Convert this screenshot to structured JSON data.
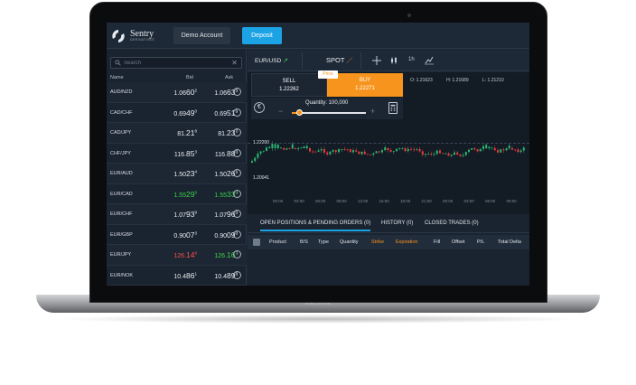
{
  "device": {
    "brand": "MacBook"
  },
  "topbar": {
    "logo_name": "Sentry",
    "logo_sub": "DERIVATIVES",
    "demo_label": "Demo Account",
    "deposit_label": "Deposit"
  },
  "watchlist": {
    "search_placeholder": "Search",
    "clear_glyph": "✕",
    "headers": {
      "name": "Name",
      "bid": "Bid",
      "ask": "Ask"
    },
    "rows": [
      {
        "symbol": "AUD/NZD",
        "bid_pre": "1.06",
        "bid_big": "60",
        "bid_sup": "2",
        "bid_color": "",
        "ask_pre": "1.06",
        "ask_big": "63",
        "ask_sup": "5",
        "ask_color": ""
      },
      {
        "symbol": "CAD/CHF",
        "bid_pre": "0.69",
        "bid_big": "49",
        "bid_sup": "0",
        "bid_color": "",
        "ask_pre": "0.69",
        "ask_big": "51",
        "ask_sup": "9",
        "ask_color": ""
      },
      {
        "symbol": "CAD/JPY",
        "bid_pre": "81.",
        "bid_big": "21",
        "bid_sup": "8",
        "bid_color": "",
        "ask_pre": "81.",
        "ask_big": "23",
        "ask_sup": "7",
        "ask_color": ""
      },
      {
        "symbol": "CHF/JPY",
        "bid_pre": "116.",
        "bid_big": "85",
        "bid_sup": "3",
        "bid_color": "",
        "ask_pre": "116.",
        "ask_big": "88",
        "ask_sup": "0",
        "ask_color": ""
      },
      {
        "symbol": "EUR/AUD",
        "bid_pre": "1.50",
        "bid_big": "23",
        "bid_sup": "4",
        "bid_color": "",
        "ask_pre": "1.50",
        "ask_big": "26",
        "ask_sup": "1",
        "ask_color": ""
      },
      {
        "symbol": "EUR/CAD",
        "bid_pre": "1.55",
        "bid_big": "29",
        "bid_sup": "9",
        "bid_color": "green",
        "ask_pre": "1.55",
        "ask_big": "33",
        "ask_sup": "0",
        "ask_color": "green"
      },
      {
        "symbol": "EUR/CHF",
        "bid_pre": "1.07",
        "bid_big": "93",
        "bid_sup": "9",
        "bid_color": "",
        "ask_pre": "1.07",
        "ask_big": "96",
        "ask_sup": "0",
        "ask_color": ""
      },
      {
        "symbol": "EUR/GBP",
        "bid_pre": "0.90",
        "bid_big": "07",
        "bid_sup": "3",
        "bid_color": "",
        "ask_pre": "0.90",
        "ask_big": "09",
        "ask_sup": "0",
        "ask_color": ""
      },
      {
        "symbol": "EUR/JPY",
        "bid_pre": "126.",
        "bid_big": "14",
        "bid_sup": "8",
        "bid_color": "red",
        "ask_pre": "126.",
        "ask_big": "16",
        "ask_sup": "7",
        "ask_color": "green"
      },
      {
        "symbol": "EUR/NOK",
        "bid_pre": "10.4",
        "bid_big": "86",
        "bid_sup": "1",
        "bid_color": "",
        "ask_pre": "10.4",
        "ask_big": "89",
        "ask_sup": "8",
        "ask_color": ""
      }
    ]
  },
  "chart_toolbar": {
    "pair": "EUR/USD",
    "pair_arrow": "↗",
    "spot": "SPOT",
    "spot_icon": "pencil-icon",
    "timeframe": "1h"
  },
  "trade": {
    "sell_label": "SELL",
    "sell_price": "1.22262",
    "buy_label": "BUY",
    "buy_price": "1.22271",
    "price_tag": "Price",
    "currency": "€",
    "quantity_label": "Quantity: 100,000",
    "minus": "−",
    "plus": "+",
    "quantity_level": 0.1
  },
  "ohlc": {
    "o": "O: 1.21623",
    "h": "H: 1.21689",
    "l": "L: 1.21210"
  },
  "chart": {
    "level_top": "1.22200",
    "level_bottom": "1.20041",
    "x_ticks": [
      "00:00",
      "03:00",
      "06:00",
      "09:00",
      "12:00",
      "15:00",
      "18:00",
      "21:00",
      "00:00",
      "03:00",
      "06:00",
      "09:00"
    ],
    "up_color": "#2bb673",
    "down_color": "#ef3b3b"
  },
  "orders": {
    "tabs": [
      "OPEN POSITIONS & PENDING ORDERS (0)",
      "HISTORY (0)",
      "CLOSED TRADES (0)"
    ],
    "columns": [
      "Product",
      "B/S",
      "Type",
      "Quantity",
      "Strike",
      "Expiration",
      "Fill",
      "Offset",
      "P/L",
      "Total Delta"
    ]
  }
}
